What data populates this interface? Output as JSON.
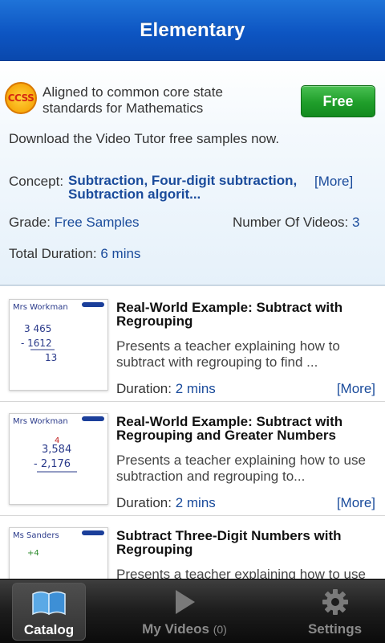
{
  "header": {
    "title": "Elementary"
  },
  "info": {
    "logo_text": "CCSS",
    "aligned_text": "Aligned to common core state standards for Mathematics",
    "free_button": "Free",
    "download_text": "Download the Video Tutor free samples now.",
    "concept_label": "Concept:",
    "concept_value": "Subtraction, Four-digit subtraction, Subtraction algorit...",
    "concept_more": "[More]",
    "grade_label": "Grade:",
    "grade_value": "Free Samples",
    "videos_label": "Number Of Videos:",
    "videos_value": "3",
    "duration_label": "Total Duration:",
    "duration_value": "6 mins"
  },
  "videos": [
    {
      "title": "Real-World Example: Subtract with Regrouping",
      "description": "Presents a teacher explaining how to subtract with regrouping to find ...",
      "duration_label": "Duration:",
      "duration": "2 mins",
      "more": "[More]",
      "thumb_text": [
        "Mrs Workman",
        "3 465",
        "- 1612",
        "13"
      ]
    },
    {
      "title": "Real-World Example: Subtract with Regrouping and Greater Numbers",
      "description": "Presents a teacher explaining how to use subtraction and regrouping to...",
      "duration_label": "Duration:",
      "duration": "2 mins",
      "more": "[More]",
      "thumb_text": [
        "Mrs Workman",
        "3,584",
        "- 2,176"
      ]
    },
    {
      "title": "Subtract Three-Digit Numbers with Regrouping",
      "description": "Presents a teacher explaining how to use",
      "duration_label": "Duration:",
      "duration": "",
      "more": "",
      "thumb_text": [
        "Ms Sanders"
      ]
    }
  ],
  "tabbar": {
    "tabs": [
      {
        "label": "Catalog",
        "icon": "book-icon",
        "active": true
      },
      {
        "label": "My Videos",
        "count": "(0)",
        "icon": "play-icon",
        "active": false
      },
      {
        "label": "Settings",
        "icon": "gear-icon",
        "active": false
      }
    ]
  },
  "colors": {
    "header_blue": "#0d55c2",
    "link_blue": "#1a4b9b",
    "free_green": "#1f9e2a",
    "tabbar_black": "#1c1c1c"
  }
}
